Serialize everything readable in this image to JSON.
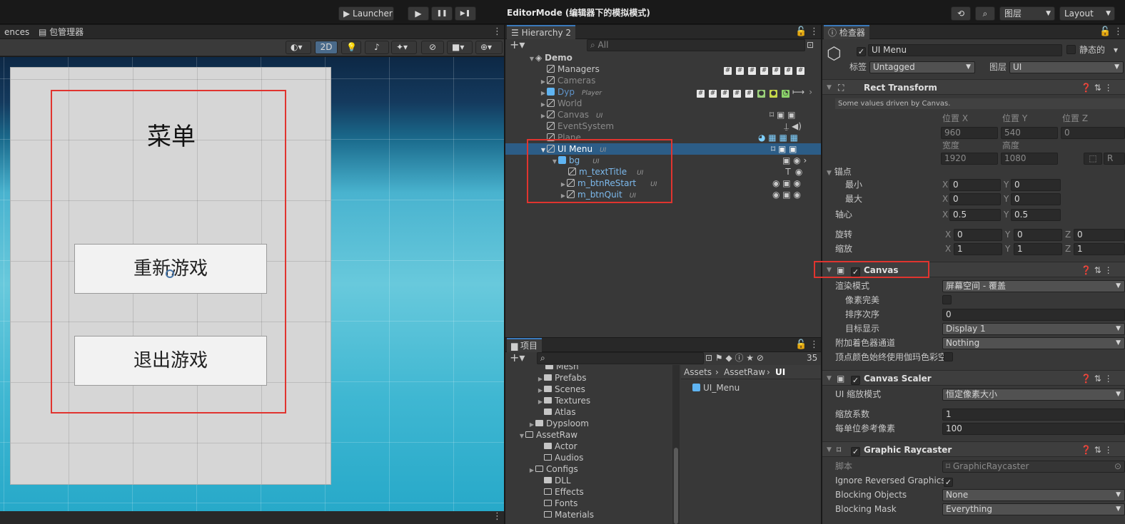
{
  "toolbar": {
    "launcher": "▶ Launcher",
    "play": "▶",
    "pause": "❚❚",
    "step": "▶❚",
    "mode": "EditorMode (编辑器下的模拟模式)",
    "layer_drop": "图层",
    "layout_drop": "Layout"
  },
  "scene": {
    "tab_prefs": "ences",
    "tab_pkg": "包管理器",
    "btn_2d": "2D",
    "menu_title": "菜单",
    "btn_restart": "重新游戏",
    "btn_quit": "退出游戏"
  },
  "hierarchy": {
    "tab": "Hierarchy 2",
    "search_placeholder": "All",
    "items": [
      {
        "name": "Demo",
        "tag": ""
      },
      {
        "name": "Managers",
        "tag": ""
      },
      {
        "name": "Cameras",
        "tag": ""
      },
      {
        "name": "Dyp",
        "tag": "Player"
      },
      {
        "name": "World",
        "tag": ""
      },
      {
        "name": "Canvas",
        "tag": "UI"
      },
      {
        "name": "EventSystem",
        "tag": ""
      },
      {
        "name": "Plane",
        "tag": ""
      },
      {
        "name": "UI Menu",
        "tag": "UI"
      },
      {
        "name": "bg",
        "tag": "UI"
      },
      {
        "name": "m_textTitle",
        "tag": "UI"
      },
      {
        "name": "m_btnReStart",
        "tag": "UI"
      },
      {
        "name": "m_btnQuit",
        "tag": "UI"
      }
    ]
  },
  "project": {
    "tab": "项目",
    "count": "35",
    "breadcrumb": [
      "Assets",
      "AssetRaw",
      "UI"
    ],
    "asset": "UI_Menu",
    "tree": [
      "Mesh",
      "Prefabs",
      "Scenes",
      "Textures",
      "Atlas",
      "Dypsloom",
      "AssetRaw",
      "Actor",
      "Audios",
      "Configs",
      "DLL",
      "Effects",
      "Fonts",
      "Materials"
    ]
  },
  "inspector": {
    "tab": "检查器",
    "object_name": "UI Menu",
    "static_label": "静态的",
    "tag_label": "标签",
    "tag_value": "Untagged",
    "layer_label": "图层",
    "layer_value": "UI",
    "rect": {
      "title": "Rect Transform",
      "note": "Some values driven by Canvas.",
      "pos_x_label": "位置 X",
      "pos_y_label": "位置 Y",
      "pos_z_label": "位置 Z",
      "pos_x": "960",
      "pos_y": "540",
      "pos_z": "0",
      "width_label": "宽度",
      "height_label": "高度",
      "width": "1920",
      "height": "1080",
      "anchors": "锚点",
      "min": "最小",
      "max": "最大",
      "pivot": "轴心",
      "rotation": "旋转",
      "scale": "缩放",
      "x": "X",
      "y": "Y",
      "z": "Z",
      "min_x": "0",
      "min_y": "0",
      "max_x": "0",
      "max_y": "0",
      "pivot_x": "0.5",
      "pivot_y": "0.5",
      "rot_x": "0",
      "rot_y": "0",
      "rot_z": "0",
      "sc_x": "1",
      "sc_y": "1",
      "sc_z": "1",
      "r": "R"
    },
    "canvas": {
      "title": "Canvas",
      "render_mode_label": "渲染模式",
      "render_mode": "屏幕空间 - 覆盖",
      "pixel_perfect": "像素完美",
      "sort_order_label": "排序次序",
      "sort_order": "0",
      "target_display_label": "目标显示",
      "target_display": "Display 1",
      "shader_channels_label": "附加着色器通道",
      "shader_channels": "Nothing",
      "vertex_gamma": "顶点颜色始终使用伽玛色彩空"
    },
    "scaler": {
      "title": "Canvas Scaler",
      "mode_label": "UI 缩放模式",
      "mode": "恒定像素大小",
      "factor_label": "缩放系数",
      "factor": "1",
      "ref_ppu_label": "每单位参考像素",
      "ref_ppu": "100"
    },
    "raycaster": {
      "title": "Graphic Raycaster",
      "script_label": "脚本",
      "script": "GraphicRaycaster",
      "ignore_reversed": "Ignore Reversed Graphics",
      "blocking_objects_label": "Blocking Objects",
      "blocking_objects": "None",
      "blocking_mask_label": "Blocking Mask",
      "blocking_mask": "Everything"
    }
  },
  "colors": {
    "accent": "#3a79bb",
    "highlight": "#2c5d87",
    "red_box": "#e0342f"
  }
}
